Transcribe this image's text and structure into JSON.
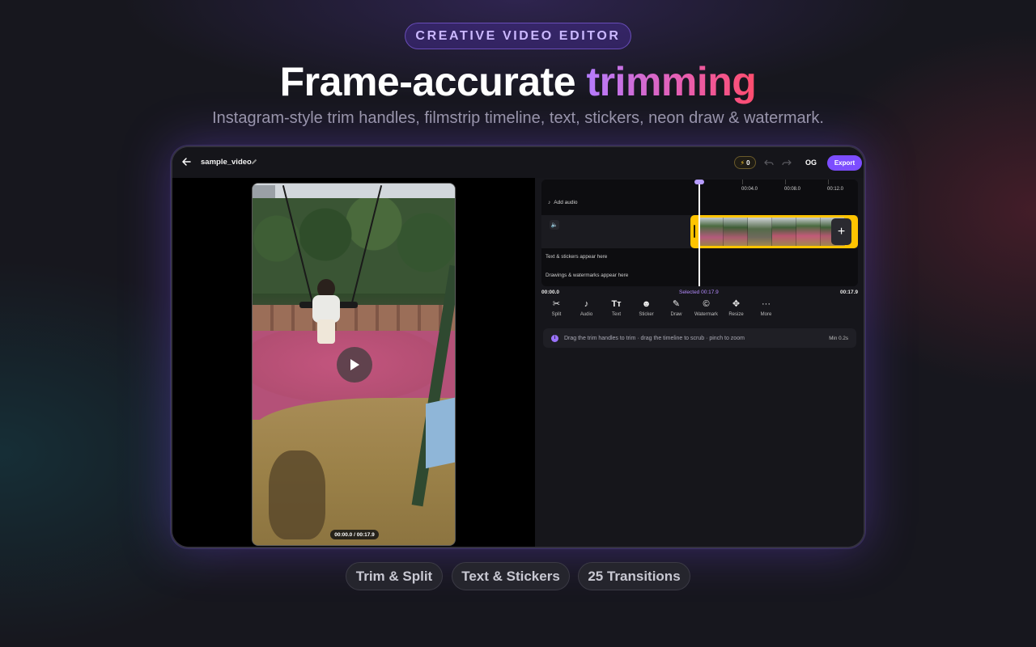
{
  "badge": "CREATIVE VIDEO EDITOR",
  "headline": {
    "prefix": "Frame-accurate ",
    "highlight": "trimming"
  },
  "subtitle": "Instagram-style trim handles, filmstrip timeline, text, stickers, neon draw & watermark.",
  "editor": {
    "filename": "sample_video",
    "credits": "0",
    "og_label": "OG",
    "export_label": "Export",
    "video_time": "00:00.0 / 00:17.9",
    "ruler": [
      "00:04.0",
      "00:08.0",
      "00:12.0"
    ],
    "add_audio": "Add audio",
    "text_track": "Text & stickers appear here",
    "draw_track": "Drawings & watermarks appear here",
    "time_start": "00:00.0",
    "time_selected": "Selected 00:17.9",
    "time_end": "00:17.9",
    "tools": [
      {
        "label": "Split",
        "icon": "scissors-icon"
      },
      {
        "label": "Audio",
        "icon": "music-note-icon"
      },
      {
        "label": "Text",
        "icon": "text-icon"
      },
      {
        "label": "Sticker",
        "icon": "smiley-icon"
      },
      {
        "label": "Draw",
        "icon": "brush-icon"
      },
      {
        "label": "Watermark",
        "icon": "copyright-icon"
      },
      {
        "label": "Resize",
        "icon": "resize-arrows-icon"
      },
      {
        "label": "More",
        "icon": "more-dots-icon"
      }
    ],
    "hint": "Drag the trim handles to trim · drag the timeline to scrub · pinch to zoom",
    "min_label": "Min 0.2s"
  },
  "features": [
    "Trim & Split",
    "Text & Stickers",
    "25 Transitions"
  ],
  "colors": {
    "accent": "#7c4dff",
    "trim_handle": "#ffc400",
    "gradient_start": "#b57cff",
    "gradient_end": "#ff4d6d"
  }
}
